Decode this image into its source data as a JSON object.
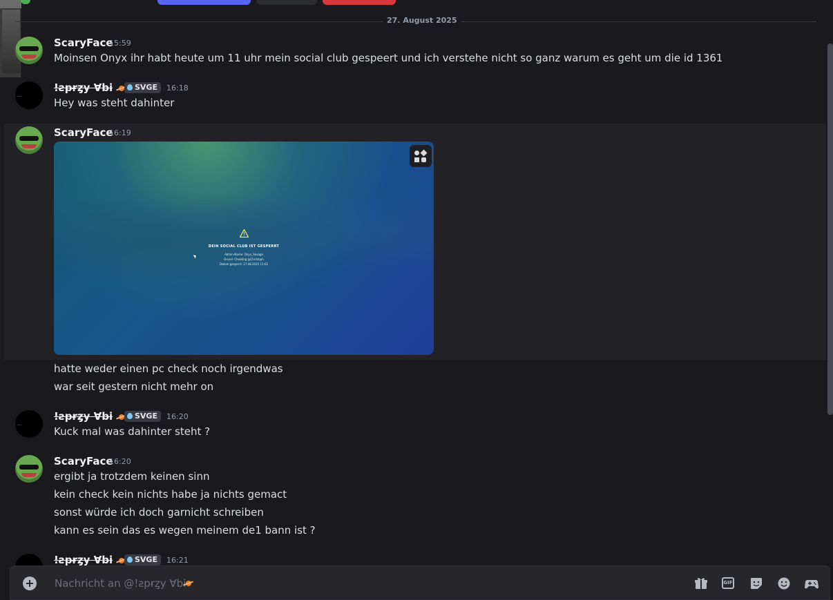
{
  "top_buttons": [
    {
      "color": "#5865f2"
    },
    {
      "color": "#2b2d31"
    },
    {
      "color": "#da373c"
    }
  ],
  "date_divider": "27. August 2025",
  "messages": [
    {
      "author": "ScaryFace",
      "time": "15:59",
      "lines": [
        "Moinsen Onyx ihr habt heute um 11 uhr mein social club gespeert und ich verstehe nicht so ganz warum es geht um die id 1361"
      ]
    },
    {
      "author": "!ƨpɍȥy Ɐbi",
      "tag": "SVGE",
      "time": "16:18",
      "lines": [
        "Hey was steht dahinter"
      ]
    },
    {
      "author": "ScaryFace",
      "time": "16:19",
      "attachment": {
        "title": "DEIN SOCIAL CLUB IST GESPERRT",
        "lines": [
          "Admin-Name: Onyx_Savage",
          "Grund: Cheating @Christoph",
          "Datum gesperrt: 27.08.2025 11:02"
        ]
      },
      "lines": [
        "hatte weder einen pc check noch irgendwas",
        "war seit gestern nicht mehr on"
      ]
    },
    {
      "author": "!ƨpɍȥy Ɐbi",
      "tag": "SVGE",
      "time": "16:20",
      "lines": [
        "Kuck mal was dahinter steht ?"
      ]
    },
    {
      "author": "ScaryFace",
      "time": "16:20",
      "lines": [
        "ergibt ja trotzdem keinen sinn",
        "kein check kein nichts habe ja nichts gemact",
        "sonst würde ich doch garnicht schreiben",
        "kann es sein das es wegen meinem de1 bann ist ?"
      ]
    },
    {
      "author": "!ƨpɍȥy Ɐbi",
      "tag": "SVGE",
      "time": "16:21",
      "lines": []
    }
  ],
  "composer": {
    "placeholder": "Nachricht an @!ƨpɍȥy Ɐbi"
  },
  "composer_icons": [
    "gift-icon",
    "gif-icon",
    "sticker-icon",
    "emoji-icon",
    "game-controller-icon"
  ],
  "gif_label": "GIF"
}
